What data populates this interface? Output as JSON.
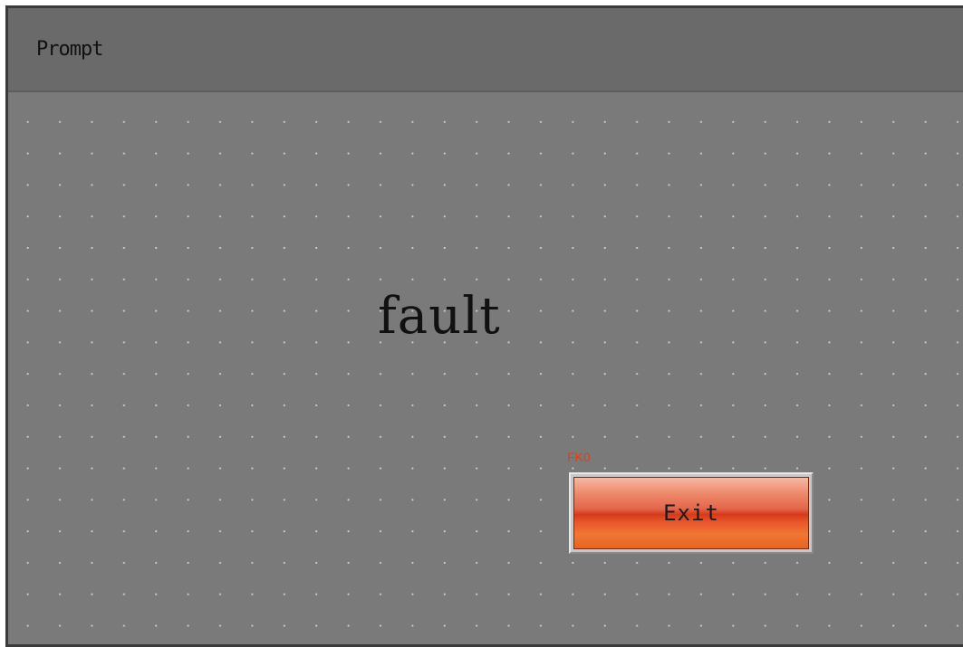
{
  "window": {
    "title": "Prompt"
  },
  "dialog": {
    "message": "fault",
    "function_key_label": "FK0",
    "exit_label": "Exit"
  },
  "colors": {
    "background": "#7a7a7a",
    "titlebar": "#6a6a6a",
    "fk_label": "#e04010",
    "exit_button": "#e04a1f"
  }
}
